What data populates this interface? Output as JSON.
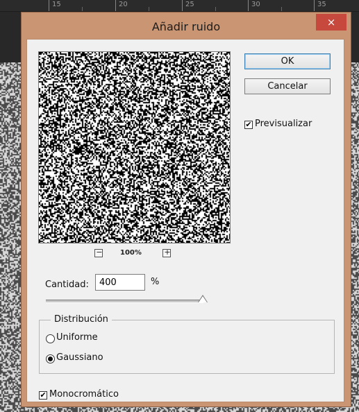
{
  "ruler": {
    "labels": [
      "15",
      "20",
      "25",
      "30",
      "35"
    ]
  },
  "dialog": {
    "title": "Añadir ruido",
    "close_glyph": "×"
  },
  "buttons": {
    "ok": "OK",
    "cancel": "Cancelar"
  },
  "preview_toggle": {
    "label": "Previsualizar",
    "checked": true
  },
  "zoom": {
    "minus": "−",
    "value": "100%",
    "plus": "+"
  },
  "amount": {
    "label": "Cantidad:",
    "value": "400",
    "unit": "%",
    "slider_fraction": 1.0
  },
  "distribution": {
    "legend": "Distribución",
    "options": [
      {
        "label": "Uniforme",
        "selected": false
      },
      {
        "label": "Gaussiano",
        "selected": true
      }
    ]
  },
  "monochrome": {
    "label": "Monocromático",
    "checked": true
  },
  "colors": {
    "dialog_frame": "#c99573",
    "close_button": "#c7483d",
    "client": "#f0f0f0",
    "ok_border": "#3c7fb1"
  },
  "icons": {
    "close": "close-icon",
    "check": "check-icon",
    "zoom_out": "zoom-out-icon",
    "zoom_in": "zoom-in-icon"
  }
}
